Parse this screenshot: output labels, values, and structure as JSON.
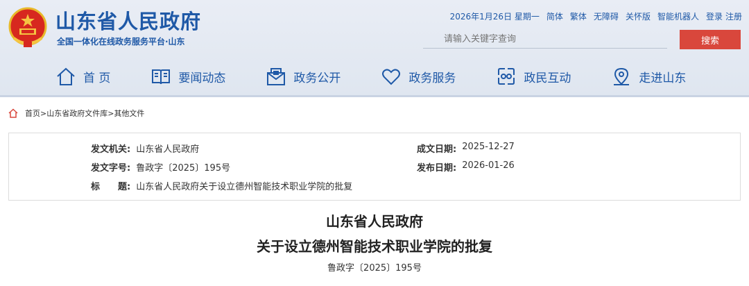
{
  "header": {
    "site_title": "山东省人民政府",
    "site_subtitle": "全国一体化在线政务服务平台·山东",
    "date": "2026年1月26日 星期一",
    "links": [
      "简体",
      "繁体",
      "无障碍",
      "关怀版",
      "智能机器人",
      "登录",
      "注册"
    ],
    "search_placeholder": "请输入关键字查询",
    "search_button": "搜索"
  },
  "nav": [
    {
      "label": "首 页",
      "icon": "home-icon"
    },
    {
      "label": "要闻动态",
      "icon": "news-icon"
    },
    {
      "label": "政务公开",
      "icon": "mail-icon"
    },
    {
      "label": "政务服务",
      "icon": "heart-icon"
    },
    {
      "label": "政民互动",
      "icon": "interact-icon"
    },
    {
      "label": "走进山东",
      "icon": "location-icon"
    }
  ],
  "breadcrumb": [
    "首页",
    ">",
    "山东省政府文件库",
    ">",
    "其他文件"
  ],
  "meta": {
    "issuer_label": "发文机关:",
    "issuer": "山东省人民政府",
    "number_label": "发文字号:",
    "number": "鲁政字〔2025〕195号",
    "title_label": "标　　题:",
    "title": "山东省人民政府关于设立德州智能技术职业学院的批复",
    "created_label": "成文日期:",
    "created": "2025-12-27",
    "published_label": "发布日期:",
    "published": "2026-01-26"
  },
  "document": {
    "title_line1": "山东省人民政府",
    "title_line2": "关于设立德州智能技术职业学院的批复",
    "doc_number": "鲁政字〔2025〕195号"
  },
  "colors": {
    "brand_blue": "#1f59a7",
    "search_red": "#d9473c"
  }
}
